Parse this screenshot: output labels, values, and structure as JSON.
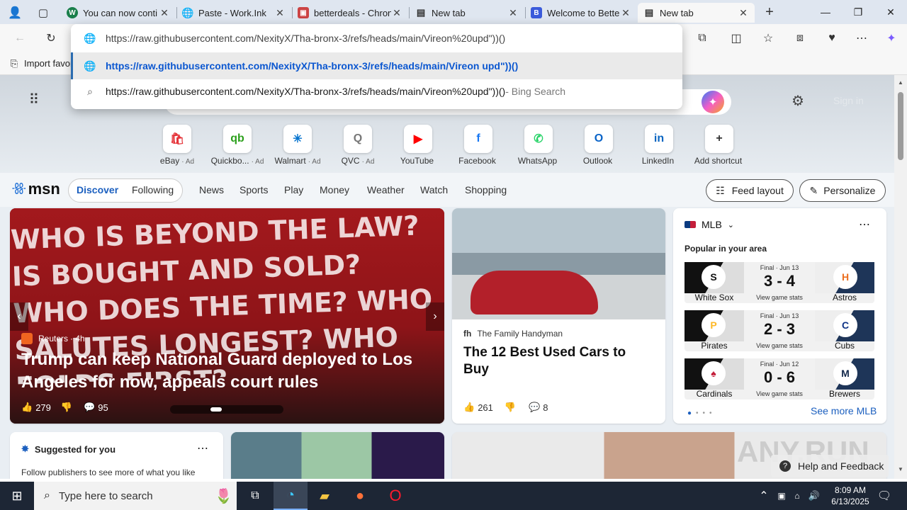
{
  "tabs": [
    {
      "title": "You can now conti",
      "favicon_color": "#1a7f4b",
      "favicon_glyph": "W",
      "icon": "whatsapp-favicon"
    },
    {
      "title": "Paste - Work.Ink",
      "favicon_color": "#444",
      "favicon_glyph": "◯",
      "icon": "globe-favicon"
    },
    {
      "title": "betterdeals - Chron",
      "favicon_color": "#c44",
      "favicon_glyph": "▣",
      "icon": "page-favicon"
    },
    {
      "title": "New tab",
      "favicon_color": "#555",
      "favicon_glyph": "▤",
      "icon": "newtab-favicon"
    },
    {
      "title": "Welcome to Better",
      "favicon_color": "#3b5bdb",
      "favicon_glyph": "B",
      "icon": "bd-favicon"
    },
    {
      "title": "New tab",
      "favicon_color": "#555",
      "favicon_glyph": "▤",
      "icon": "newtab-favicon"
    }
  ],
  "address": {
    "value": "https://raw.githubusercontent.com/NexityX/Tha-bronx-3/refs/heads/main/Vireon%20upd\"))()"
  },
  "dropdown": {
    "row1": "https://raw.githubusercontent.com/NexityX/Tha-bronx-3/refs/heads/main/Vireon upd\"))()",
    "row2_query": "https://raw.githubusercontent.com/NexityX/Tha-bronx-3/refs/heads/main/Vireon%20upd\"))()",
    "row2_suffix": " - Bing Search"
  },
  "bookmarks": {
    "import": "Import favor"
  },
  "msn": {
    "signin": "Sign in"
  },
  "shortcuts": [
    {
      "label": "eBay",
      "ad": "· Ad",
      "glyph": "🛍",
      "color": "#e53238"
    },
    {
      "label": "Quickbo...",
      "ad": "· Ad",
      "glyph": "qb",
      "color": "#2ca01c"
    },
    {
      "label": "Walmart",
      "ad": "· Ad",
      "glyph": "✳",
      "color": "#0071ce"
    },
    {
      "label": "QVC",
      "ad": "· Ad",
      "glyph": "Q",
      "color": "#777"
    },
    {
      "label": "YouTube",
      "ad": "",
      "glyph": "▶",
      "color": "#ff0000"
    },
    {
      "label": "Facebook",
      "ad": "",
      "glyph": "f",
      "color": "#1877f2"
    },
    {
      "label": "WhatsApp",
      "ad": "",
      "glyph": "✆",
      "color": "#25d366"
    },
    {
      "label": "Outlook",
      "ad": "",
      "glyph": "O",
      "color": "#0a64c8"
    },
    {
      "label": "LinkedIn",
      "ad": "",
      "glyph": "in",
      "color": "#0a66c2"
    },
    {
      "label": "Add shortcut",
      "ad": "",
      "glyph": "+",
      "color": "#333"
    }
  ],
  "nav": {
    "logo": "msn",
    "discover": "Discover",
    "following": "Following",
    "items": [
      "News",
      "Sports",
      "Play",
      "Money",
      "Weather",
      "Watch",
      "Shopping"
    ],
    "feed_layout": "Feed layout",
    "personalize": "Personalize"
  },
  "hero_story": {
    "source": "Reuters",
    "age": "· 4h",
    "headline": "Trump can keep National Guard deployed to Los Angeles for now, appeals court rules",
    "likes": "279",
    "comments": "95",
    "image_text": "WHO IS BEYOND THE LAW? IS BOUGHT AND SOLD? WHO DOES THE TIME? WHO SALUTES LONGEST? WHO FOLDS FIRST?"
  },
  "side_story": {
    "source": "The Family Handyman",
    "headline": "The 12 Best Used Cars to Buy",
    "likes": "261",
    "comments": "8"
  },
  "mlb": {
    "title": "MLB",
    "subtitle": "Popular in your area",
    "more": "See more MLB",
    "games": [
      {
        "home": "White Sox",
        "away": "Astros",
        "status": "Final · Jun 13",
        "score": "3 - 4",
        "stats": "View game stats",
        "hg": "S",
        "ag": "H",
        "hc": "#111",
        "ac": "#eb6e1f"
      },
      {
        "home": "Pirates",
        "away": "Cubs",
        "status": "Final · Jun 13",
        "score": "2 - 3",
        "stats": "View game stats",
        "hg": "P",
        "ag": "C",
        "hc": "#fdb827",
        "ac": "#0e3386"
      },
      {
        "home": "Cardinals",
        "away": "Brewers",
        "status": "Final · Jun 12",
        "score": "0 - 6",
        "stats": "View game stats",
        "hg": "♠",
        "ag": "M",
        "hc": "#c41e3a",
        "ac": "#12284b"
      }
    ]
  },
  "suggested": {
    "title": "Suggested for you",
    "body": "Follow publishers to see more of what you like"
  },
  "help": "Help and Feedback",
  "watermark": "ANY.RUN",
  "taskbar": {
    "search": "Type here to search",
    "time": "8:09 AM",
    "date": "6/13/2025"
  }
}
